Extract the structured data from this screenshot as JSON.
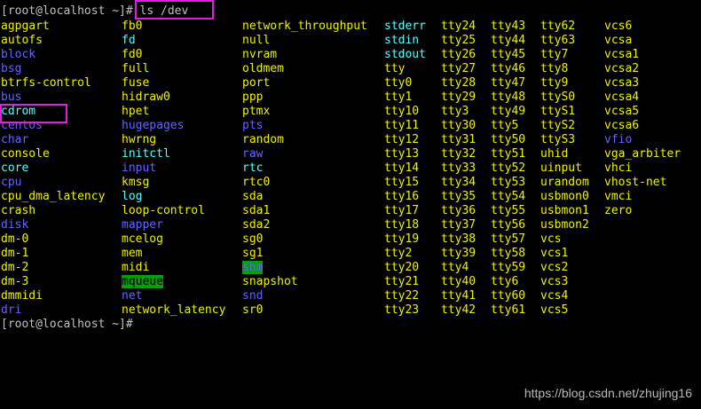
{
  "terminal": {
    "prompt_line": "[root@localhost ~]# ls /dev",
    "prompt_end": "[root@localhost ~]#",
    "watermark": "https://blog.csdn.net/zhujing16"
  },
  "colors": {
    "background": "#000000",
    "regular_file": "#c0c0c0",
    "directory": "#6464ff",
    "symlink": "#55ffff",
    "device": "#f0f000",
    "sticky_bg": "#00a000",
    "annotation_box": "#e020e0"
  },
  "listing": {
    "columns": [
      [
        {
          "name": "agpgart",
          "type": "dev"
        },
        {
          "name": "autofs",
          "type": "dev"
        },
        {
          "name": "block",
          "type": "dir"
        },
        {
          "name": "bsg",
          "type": "dir"
        },
        {
          "name": "btrfs-control",
          "type": "dev"
        },
        {
          "name": "bus",
          "type": "dir"
        },
        {
          "name": "cdrom",
          "type": "link"
        },
        {
          "name": "centos",
          "type": "dir"
        },
        {
          "name": "char",
          "type": "dir"
        },
        {
          "name": "console",
          "type": "dev"
        },
        {
          "name": "core",
          "type": "link"
        },
        {
          "name": "cpu",
          "type": "dir"
        },
        {
          "name": "cpu_dma_latency",
          "type": "dev"
        },
        {
          "name": "crash",
          "type": "dev"
        },
        {
          "name": "disk",
          "type": "dir"
        },
        {
          "name": "dm-0",
          "type": "dev"
        },
        {
          "name": "dm-1",
          "type": "dev"
        },
        {
          "name": "dm-2",
          "type": "dev"
        },
        {
          "name": "dm-3",
          "type": "dev"
        },
        {
          "name": "dmmidi",
          "type": "dev"
        },
        {
          "name": "dri",
          "type": "dir"
        }
      ],
      [
        {
          "name": "fb0",
          "type": "dev"
        },
        {
          "name": "fd",
          "type": "link"
        },
        {
          "name": "fd0",
          "type": "dev"
        },
        {
          "name": "full",
          "type": "dev"
        },
        {
          "name": "fuse",
          "type": "dev"
        },
        {
          "name": "hidraw0",
          "type": "dev"
        },
        {
          "name": "hpet",
          "type": "dev"
        },
        {
          "name": "hugepages",
          "type": "dir"
        },
        {
          "name": "hwrng",
          "type": "dev"
        },
        {
          "name": "initctl",
          "type": "link"
        },
        {
          "name": "input",
          "type": "dir"
        },
        {
          "name": "kmsg",
          "type": "dev"
        },
        {
          "name": "log",
          "type": "socket"
        },
        {
          "name": "loop-control",
          "type": "dev"
        },
        {
          "name": "mapper",
          "type": "dir"
        },
        {
          "name": "mcelog",
          "type": "dev"
        },
        {
          "name": "mem",
          "type": "dev"
        },
        {
          "name": "midi",
          "type": "dev"
        },
        {
          "name": "mqueue",
          "type": "mq"
        },
        {
          "name": "net",
          "type": "dir"
        },
        {
          "name": "network_latency",
          "type": "dev"
        }
      ],
      [
        {
          "name": "network_throughput",
          "type": "dev"
        },
        {
          "name": "null",
          "type": "dev"
        },
        {
          "name": "nvram",
          "type": "dev"
        },
        {
          "name": "oldmem",
          "type": "dev"
        },
        {
          "name": "port",
          "type": "dev"
        },
        {
          "name": "ppp",
          "type": "dev"
        },
        {
          "name": "ptmx",
          "type": "dev"
        },
        {
          "name": "pts",
          "type": "dir"
        },
        {
          "name": "random",
          "type": "dev"
        },
        {
          "name": "raw",
          "type": "dir"
        },
        {
          "name": "rtc",
          "type": "link"
        },
        {
          "name": "rtc0",
          "type": "dev"
        },
        {
          "name": "sda",
          "type": "dev"
        },
        {
          "name": "sda1",
          "type": "dev"
        },
        {
          "name": "sda2",
          "type": "dev"
        },
        {
          "name": "sg0",
          "type": "dev"
        },
        {
          "name": "sg1",
          "type": "dev"
        },
        {
          "name": "shm",
          "type": "shm"
        },
        {
          "name": "snapshot",
          "type": "dev"
        },
        {
          "name": "snd",
          "type": "dir"
        },
        {
          "name": "sr0",
          "type": "dev"
        }
      ],
      [
        {
          "name": "stderr",
          "type": "link"
        },
        {
          "name": "stdin",
          "type": "link"
        },
        {
          "name": "stdout",
          "type": "link"
        },
        {
          "name": "tty",
          "type": "dev"
        },
        {
          "name": "tty0",
          "type": "dev"
        },
        {
          "name": "tty1",
          "type": "dev"
        },
        {
          "name": "tty10",
          "type": "dev"
        },
        {
          "name": "tty11",
          "type": "dev"
        },
        {
          "name": "tty12",
          "type": "dev"
        },
        {
          "name": "tty13",
          "type": "dev"
        },
        {
          "name": "tty14",
          "type": "dev"
        },
        {
          "name": "tty15",
          "type": "dev"
        },
        {
          "name": "tty16",
          "type": "dev"
        },
        {
          "name": "tty17",
          "type": "dev"
        },
        {
          "name": "tty18",
          "type": "dev"
        },
        {
          "name": "tty19",
          "type": "dev"
        },
        {
          "name": "tty2",
          "type": "dev"
        },
        {
          "name": "tty20",
          "type": "dev"
        },
        {
          "name": "tty21",
          "type": "dev"
        },
        {
          "name": "tty22",
          "type": "dev"
        },
        {
          "name": "tty23",
          "type": "dev"
        }
      ],
      [
        {
          "name": "tty24",
          "type": "dev"
        },
        {
          "name": "tty25",
          "type": "dev"
        },
        {
          "name": "tty26",
          "type": "dev"
        },
        {
          "name": "tty27",
          "type": "dev"
        },
        {
          "name": "tty28",
          "type": "dev"
        },
        {
          "name": "tty29",
          "type": "dev"
        },
        {
          "name": "tty3",
          "type": "dev"
        },
        {
          "name": "tty30",
          "type": "dev"
        },
        {
          "name": "tty31",
          "type": "dev"
        },
        {
          "name": "tty32",
          "type": "dev"
        },
        {
          "name": "tty33",
          "type": "dev"
        },
        {
          "name": "tty34",
          "type": "dev"
        },
        {
          "name": "tty35",
          "type": "dev"
        },
        {
          "name": "tty36",
          "type": "dev"
        },
        {
          "name": "tty37",
          "type": "dev"
        },
        {
          "name": "tty38",
          "type": "dev"
        },
        {
          "name": "tty39",
          "type": "dev"
        },
        {
          "name": "tty4",
          "type": "dev"
        },
        {
          "name": "tty40",
          "type": "dev"
        },
        {
          "name": "tty41",
          "type": "dev"
        },
        {
          "name": "tty42",
          "type": "dev"
        }
      ],
      [
        {
          "name": "tty43",
          "type": "dev"
        },
        {
          "name": "tty44",
          "type": "dev"
        },
        {
          "name": "tty45",
          "type": "dev"
        },
        {
          "name": "tty46",
          "type": "dev"
        },
        {
          "name": "tty47",
          "type": "dev"
        },
        {
          "name": "tty48",
          "type": "dev"
        },
        {
          "name": "tty49",
          "type": "dev"
        },
        {
          "name": "tty5",
          "type": "dev"
        },
        {
          "name": "tty50",
          "type": "dev"
        },
        {
          "name": "tty51",
          "type": "dev"
        },
        {
          "name": "tty52",
          "type": "dev"
        },
        {
          "name": "tty53",
          "type": "dev"
        },
        {
          "name": "tty54",
          "type": "dev"
        },
        {
          "name": "tty55",
          "type": "dev"
        },
        {
          "name": "tty56",
          "type": "dev"
        },
        {
          "name": "tty57",
          "type": "dev"
        },
        {
          "name": "tty58",
          "type": "dev"
        },
        {
          "name": "tty59",
          "type": "dev"
        },
        {
          "name": "tty6",
          "type": "dev"
        },
        {
          "name": "tty60",
          "type": "dev"
        },
        {
          "name": "tty61",
          "type": "dev"
        }
      ],
      [
        {
          "name": "tty62",
          "type": "dev"
        },
        {
          "name": "tty63",
          "type": "dev"
        },
        {
          "name": "tty7",
          "type": "dev"
        },
        {
          "name": "tty8",
          "type": "dev"
        },
        {
          "name": "tty9",
          "type": "dev"
        },
        {
          "name": "ttyS0",
          "type": "dev"
        },
        {
          "name": "ttyS1",
          "type": "dev"
        },
        {
          "name": "ttyS2",
          "type": "dev"
        },
        {
          "name": "ttyS3",
          "type": "dev"
        },
        {
          "name": "uhid",
          "type": "dev"
        },
        {
          "name": "uinput",
          "type": "dev"
        },
        {
          "name": "urandom",
          "type": "dev"
        },
        {
          "name": "usbmon0",
          "type": "dev"
        },
        {
          "name": "usbmon1",
          "type": "dev"
        },
        {
          "name": "usbmon2",
          "type": "dev"
        },
        {
          "name": "vcs",
          "type": "dev"
        },
        {
          "name": "vcs1",
          "type": "dev"
        },
        {
          "name": "vcs2",
          "type": "dev"
        },
        {
          "name": "vcs3",
          "type": "dev"
        },
        {
          "name": "vcs4",
          "type": "dev"
        },
        {
          "name": "vcs5",
          "type": "dev"
        }
      ],
      [
        {
          "name": "vcs6",
          "type": "dev"
        },
        {
          "name": "vcsa",
          "type": "dev"
        },
        {
          "name": "vcsa1",
          "type": "dev"
        },
        {
          "name": "vcsa2",
          "type": "dev"
        },
        {
          "name": "vcsa3",
          "type": "dev"
        },
        {
          "name": "vcsa4",
          "type": "dev"
        },
        {
          "name": "vcsa5",
          "type": "dev"
        },
        {
          "name": "vcsa6",
          "type": "dev"
        },
        {
          "name": "vfio",
          "type": "dir"
        },
        {
          "name": "vga_arbiter",
          "type": "dev"
        },
        {
          "name": "vhci",
          "type": "dev"
        },
        {
          "name": "vhost-net",
          "type": "dev"
        },
        {
          "name": "vmci",
          "type": "dev"
        },
        {
          "name": "zero",
          "type": "dev"
        }
      ]
    ]
  }
}
